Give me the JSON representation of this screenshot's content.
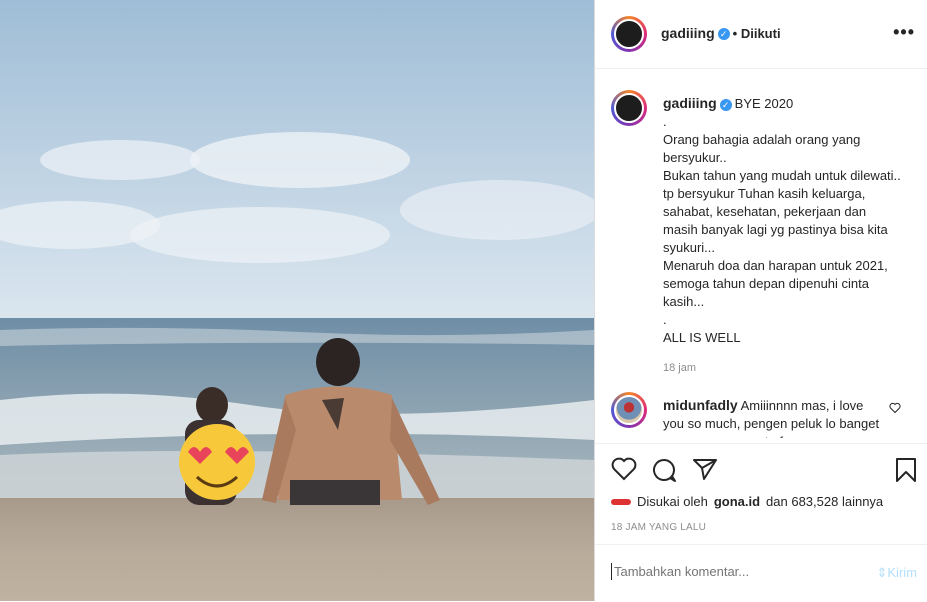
{
  "post": {
    "author": "gadiiing",
    "follow_status": "• Diikuti",
    "more_icon": "•••",
    "verified_icon": "✓"
  },
  "caption": {
    "author": "gadiiing",
    "lines": [
      "BYE 2020",
      ".",
      "Orang bahagia adalah orang yang bersyukur..",
      "Bukan tahun yang mudah untuk dilewati.. tp bersyukur Tuhan kasih keluarga, sahabat, kesehatan, pekerjaan dan masih banyak lagi yg pastinya bisa kita syukuri...",
      "Menaruh doa dan harapan untuk 2021, semoga tahun depan dipenuhi cinta kasih...",
      ".",
      "ALL IS WELL"
    ],
    "time": "18 jam"
  },
  "comment": {
    "author": "midunfadly",
    "text": "Amiiinnnn mas, i love you so much, pengen peluk lo banget guy u are one part of my"
  },
  "likes": {
    "prefix": "Disukai oleh",
    "user": "gona.id",
    "suffix": "dan 683,528 lainnya"
  },
  "posted_ago": "18 JAM YANG LALU",
  "add_comment": {
    "placeholder": "Tambahkan komentar...",
    "submit_label": "Kirim"
  },
  "colors": {
    "verified": "#3897f0",
    "link_disabled": "#b2dffc",
    "muted": "#8e8e8e"
  }
}
